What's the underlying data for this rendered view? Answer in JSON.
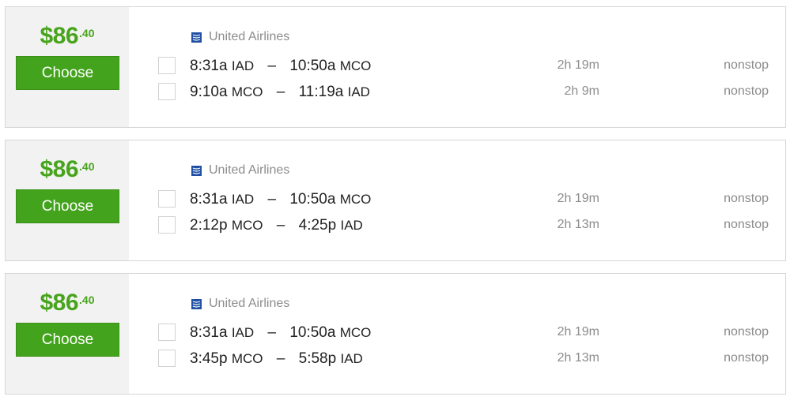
{
  "colors": {
    "accent_green": "#44a31d",
    "price_green": "#48a41c",
    "muted_text": "#8c8c8c",
    "primary_text": "#222222",
    "price_panel_bg": "#f2f2f2"
  },
  "results": [
    {
      "price": {
        "dollars": "$86",
        "cents": ".40"
      },
      "choose_label": "Choose",
      "airline": {
        "name": "United Airlines",
        "icon": "united-airlines-logo-icon"
      },
      "legs": [
        {
          "depart_time": "8:31a",
          "depart_airport": "IAD",
          "dash": "–",
          "arrive_time": "10:50a",
          "arrive_airport": "MCO",
          "duration": "2h 19m",
          "stops": "nonstop"
        },
        {
          "depart_time": "9:10a",
          "depart_airport": "MCO",
          "dash": "–",
          "arrive_time": "11:19a",
          "arrive_airport": "IAD",
          "duration": "2h 9m",
          "stops": "nonstop"
        }
      ]
    },
    {
      "price": {
        "dollars": "$86",
        "cents": ".40"
      },
      "choose_label": "Choose",
      "airline": {
        "name": "United Airlines",
        "icon": "united-airlines-logo-icon"
      },
      "legs": [
        {
          "depart_time": "8:31a",
          "depart_airport": "IAD",
          "dash": "–",
          "arrive_time": "10:50a",
          "arrive_airport": "MCO",
          "duration": "2h 19m",
          "stops": "nonstop"
        },
        {
          "depart_time": "2:12p",
          "depart_airport": "MCO",
          "dash": "–",
          "arrive_time": "4:25p",
          "arrive_airport": "IAD",
          "duration": "2h 13m",
          "stops": "nonstop"
        }
      ]
    },
    {
      "price": {
        "dollars": "$86",
        "cents": ".40"
      },
      "choose_label": "Choose",
      "airline": {
        "name": "United Airlines",
        "icon": "united-airlines-logo-icon"
      },
      "legs": [
        {
          "depart_time": "8:31a",
          "depart_airport": "IAD",
          "dash": "–",
          "arrive_time": "10:50a",
          "arrive_airport": "MCO",
          "duration": "2h 19m",
          "stops": "nonstop"
        },
        {
          "depart_time": "3:45p",
          "depart_airport": "MCO",
          "dash": "–",
          "arrive_time": "5:58p",
          "arrive_airport": "IAD",
          "duration": "2h 13m",
          "stops": "nonstop"
        }
      ]
    }
  ]
}
